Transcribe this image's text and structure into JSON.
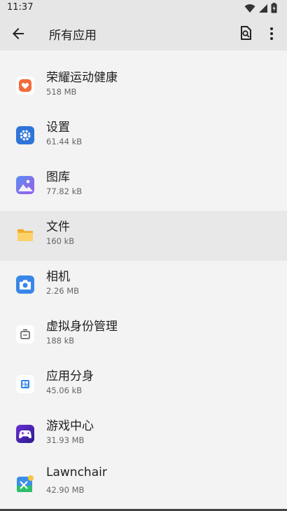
{
  "status_bar": {
    "time": "11:37"
  },
  "app_bar": {
    "title": "所有应用"
  },
  "apps": [
    {
      "name": "荣耀运动健康",
      "size": "518 MB",
      "icon": "health-heart-icon"
    },
    {
      "name": "设置",
      "size": "61.44 kB",
      "icon": "settings-gear-icon"
    },
    {
      "name": "图库",
      "size": "77.82 kB",
      "icon": "gallery-icon"
    },
    {
      "name": "文件",
      "size": "160 kB",
      "icon": "folder-icon"
    },
    {
      "name": "相机",
      "size": "2.26 MB",
      "icon": "camera-icon"
    },
    {
      "name": "虚拟身份管理",
      "size": "188 kB",
      "icon": "virtual-identity-icon"
    },
    {
      "name": "应用分身",
      "size": "45.06 kB",
      "icon": "app-clone-icon"
    },
    {
      "name": "游戏中心",
      "size": "31.93 MB",
      "icon": "gamepad-icon"
    },
    {
      "name": "Lawnchair",
      "size": "42.90 MB",
      "icon": "lawnchair-icon"
    }
  ]
}
